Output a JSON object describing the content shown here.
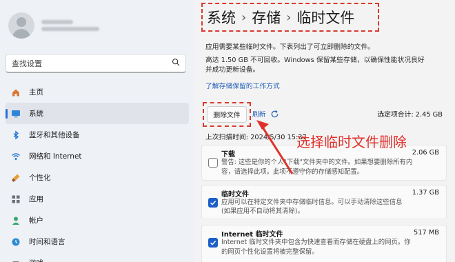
{
  "sidebar": {
    "search_placeholder": "查找设置",
    "items": [
      {
        "label": "主页",
        "icon": "home-icon"
      },
      {
        "label": "系统",
        "icon": "monitor-icon",
        "active": true
      },
      {
        "label": "蓝牙和其他设备",
        "icon": "bluetooth-icon"
      },
      {
        "label": "网络和 Internet",
        "icon": "wifi-icon"
      },
      {
        "label": "个性化",
        "icon": "brush-icon"
      },
      {
        "label": "应用",
        "icon": "apps-icon"
      },
      {
        "label": "帐户",
        "icon": "person-icon"
      },
      {
        "label": "时间和语言",
        "icon": "globe-clock-icon"
      },
      {
        "label": "游戏",
        "icon": "gamepad-icon"
      }
    ]
  },
  "breadcrumb": {
    "part1": "系统",
    "part2": "存储",
    "part3": "临时文件",
    "separator": "›"
  },
  "description": {
    "line1": "应用需要某些临时文件。下表列出了可立即删除的文件。",
    "line2": "高达 1.50 GB 不可回收。Windows 保留某些存储，以确保性能状况良好",
    "line3": "并成功更新设备。",
    "link": "了解存储保留的工作方式"
  },
  "toolbar": {
    "delete_label": "删除文件",
    "refresh_label": "刷新",
    "total": "选定项合计: 2.45 GB",
    "last_scan": "上次扫描时间: 2024/5/30 15:37"
  },
  "items": [
    {
      "title": "下载",
      "size": "2.06 GB",
      "checked": false,
      "desc1": "警告: 这些是你的个人\"下载\"文件夹中的文件。如果想要删除所有内",
      "desc2": "容，请选择此项。此项不遵守你的存储感知配置。"
    },
    {
      "title": "临时文件",
      "size": "1.37 GB",
      "checked": true,
      "desc1": "应用可以在特定文件夹中存储临时信息。可以手动清除这些信息",
      "desc2": "(如果应用不自动将其清除)。"
    },
    {
      "title": "Internet 临时文件",
      "size": "517 MB",
      "checked": true,
      "desc1": "Internet 临时文件夹中包含为快速查看而存储在硬盘上的网页。你",
      "desc2": "的网页个性化设置将被完整保留。"
    }
  ],
  "annotation": "选择临时文件删除",
  "colors": {
    "accent": "#1e5fc8",
    "annotation": "#e0302a",
    "link": "#1c5bb8"
  }
}
